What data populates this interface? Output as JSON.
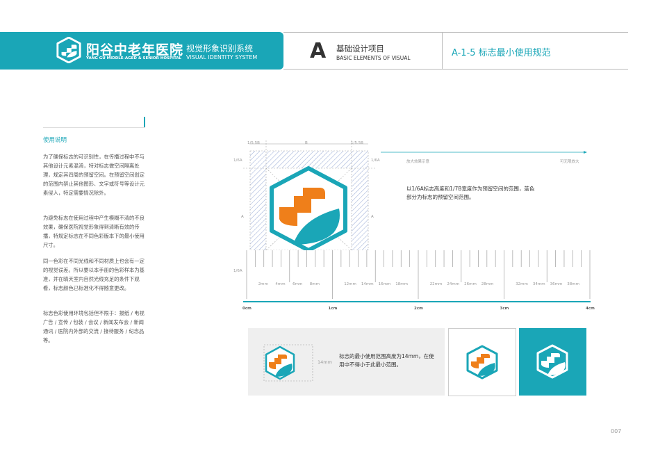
{
  "header": {
    "hospital_cn": "阳谷中老年医院",
    "hospital_en": "YANG GU MIDDLE-AGED & SENIOR HOSPITAL",
    "vi_cn": "视觉形象识别系统",
    "vi_en": "VISUAL IDENTITY SYSTEM",
    "section_letter": "A",
    "section_cn": "基础设计项目",
    "section_en": "BASIC ELEMENTS OF VISUAL",
    "page_code": "A-1-5 标志最小使用规范"
  },
  "sidebar": {
    "title": "使用说明",
    "paragraphs": [
      "为了确保标志的可识别性，在传播过程中不与其他设计元素混淆，特对标志做空间隔离处理，规定其四周的预留空间。在预留空间划定的范围内禁止其他图形、文字或符号等设计元素侵入，特定需要情况除外。",
      "为避免标志在使用过程中产生模糊不清的不良效果，确保医院视觉形象得到清晰有效的传播，特规定标志在不同色彩版本下的最小使用尺寸。",
      "同一色彩在不同光线和不同材质上也会有一定的视觉误差。所以要以本手册的色彩样本为基准，并在晴天室内自然光线充足的条件下观看，标志颜色已标准化不得随意更改。",
      "标志色彩使用环境包括但不限于：报纸 / 电视广告 / 宣传 / 包装 / 会议 / 新闻发布会 / 新闻通讯 / 医院内外部的交流 / 接待服务 / 纪念品等。"
    ]
  },
  "diagram": {
    "label_top_left": "1/5.5B",
    "label_top_mid": "B",
    "label_top_right": "1/5.5B",
    "label_left_top": "1/6A",
    "label_right_top": "1/6A",
    "label_left_mid": "A",
    "label_right_mid": "A",
    "label_left_bottom": "1/6A",
    "arrow_left": "放大效果示意",
    "arrow_right": "可无限放大",
    "note": "以1/6A标志高度和1/7B宽度作为预留空间的范围，蓝色部分为标志的预留空间范围。",
    "ruler_mm": [
      "2mm",
      "4mm",
      "6mm",
      "8mm",
      "12mm",
      "14mm",
      "16mm",
      "18mm",
      "22mm",
      "24mm",
      "26mm",
      "28mm",
      "32mm",
      "34mm",
      "36mm",
      "38mm"
    ],
    "ruler_cm": [
      "0cm",
      "1cm",
      "2cm",
      "3cm",
      "4cm"
    ]
  },
  "minsize": {
    "height_label": "14mm",
    "note": "标志的最小使用范围高度为14mm，在使用中不得小于此最小范围。"
  },
  "colors": {
    "teal": "#1aa6b7",
    "orange": "#ef7f1a",
    "grey_panel": "#efefef"
  },
  "page_number": "007"
}
